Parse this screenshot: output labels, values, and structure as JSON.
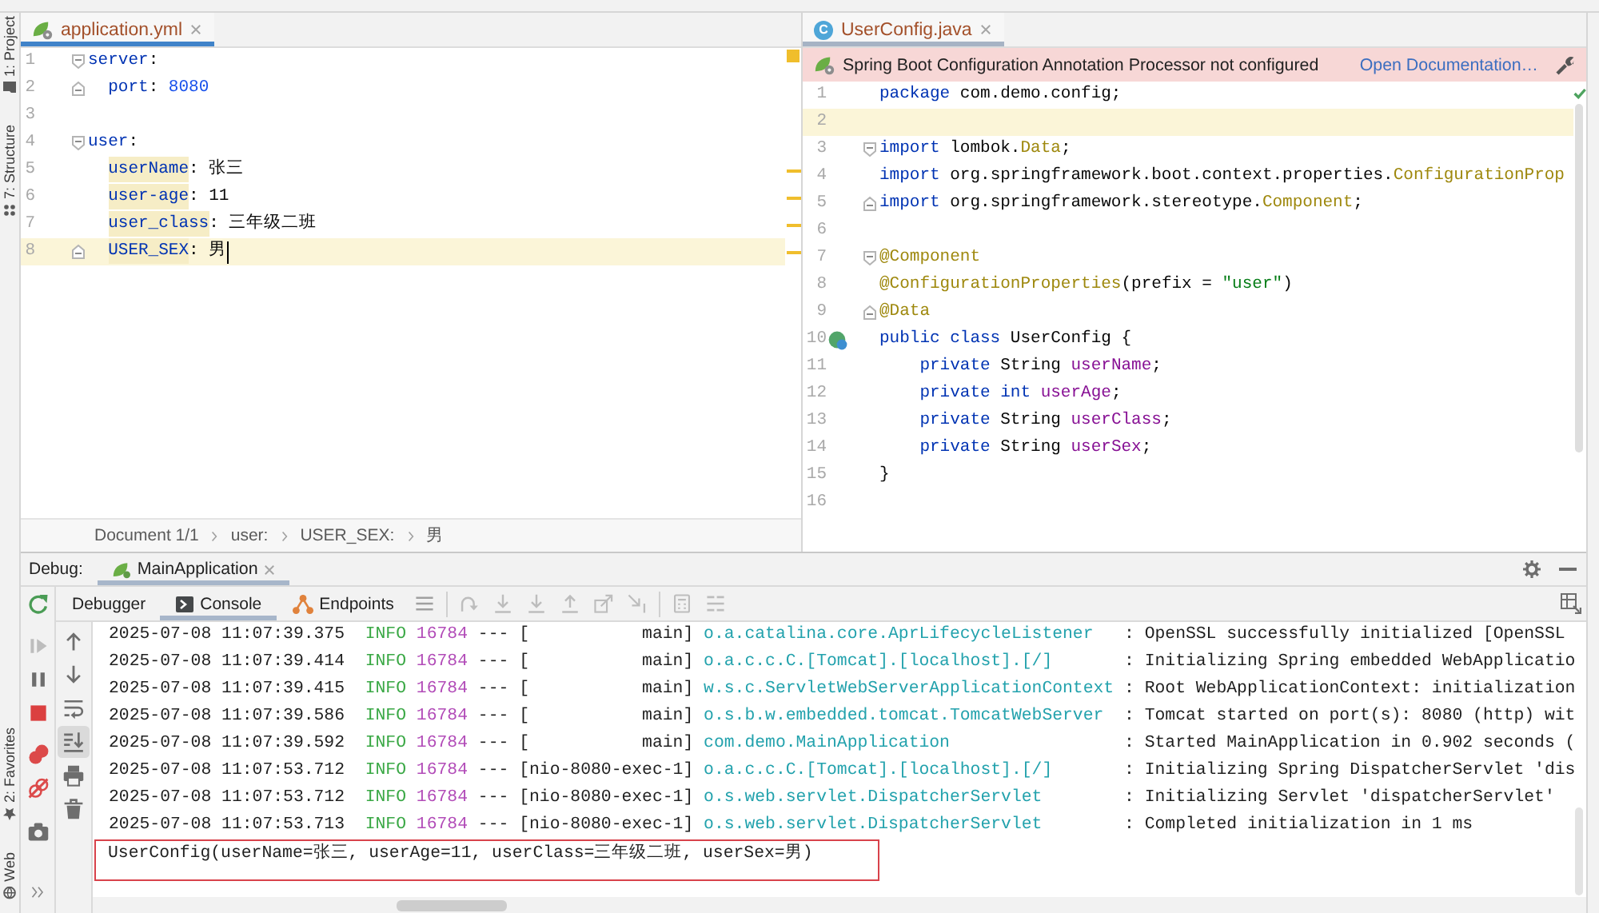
{
  "left_strip": {
    "top": [
      {
        "label": "1: Project",
        "kind": "project"
      },
      {
        "label": "7: Structure",
        "kind": "structure"
      }
    ],
    "bottom": [
      {
        "label": "2: Favorites",
        "kind": "favorites"
      },
      {
        "label": "Web",
        "kind": "web"
      }
    ]
  },
  "yaml_editor": {
    "tab": {
      "label": "application.yml",
      "kind": "yaml",
      "selected": true
    },
    "focused": true,
    "warnings": true,
    "lines": [
      {
        "number": "1",
        "marks": [
          {
            "kind": "fold_start"
          }
        ],
        "current": false,
        "tokens": [
          {
            "text": "server",
            "kind": "key"
          },
          {
            "text": ":",
            "kind": "punct"
          }
        ],
        "children": [
          {
            "number": "2",
            "marks": [
              {
                "kind": "fold_end"
              }
            ],
            "current": false,
            "tokens": [
              {
                "text": "port",
                "kind": "key"
              },
              {
                "text": ": ",
                "kind": "punct"
              },
              {
                "text": "8080",
                "kind": "number"
              }
            ]
          }
        ]
      },
      {
        "number": "3",
        "current": false
      },
      {
        "number": "4",
        "marks": [
          {
            "kind": "fold_start"
          }
        ],
        "current": false,
        "tokens": [
          {
            "text": "user",
            "kind": "key"
          },
          {
            "text": ":",
            "kind": "punct"
          }
        ],
        "children": [
          {
            "number": "5",
            "current": false,
            "tokens": [
              {
                "text": "userName",
                "kind": "flagged_key"
              },
              {
                "text": ": ",
                "kind": "punct"
              },
              {
                "text": "张三",
                "kind": "text"
              }
            ]
          },
          {
            "number": "6",
            "current": false,
            "tokens": [
              {
                "text": "user-age",
                "kind": "flagged_key"
              },
              {
                "text": ": ",
                "kind": "punct"
              },
              {
                "text": "11",
                "kind": "text"
              }
            ]
          },
          {
            "number": "7",
            "current": false,
            "tokens": [
              {
                "text": "user_class",
                "kind": "flagged_key"
              },
              {
                "text": ": ",
                "kind": "punct"
              },
              {
                "text": "三年级二班",
                "kind": "text"
              }
            ]
          },
          {
            "number": "8",
            "marks": [
              {
                "kind": "fold_end"
              }
            ],
            "current": true,
            "tokens": [
              {
                "text": "USER_SEX",
                "kind": "flagged_key"
              },
              {
                "text": ": ",
                "kind": "punct"
              },
              {
                "text": "男",
                "kind": "text"
              }
            ]
          }
        ]
      }
    ],
    "breadcrumbs": [
      "Document 1/1",
      "user:",
      "USER_SEX:",
      "男"
    ]
  },
  "java_editor": {
    "tab": {
      "label": "UserConfig.java",
      "kind": "java",
      "badge": "C",
      "selected": true
    },
    "banner": {
      "message": "Spring Boot Configuration Annotation Processor not configured",
      "link": "Open Documentation…"
    },
    "focused": false,
    "warnings": false,
    "lines": [
      {
        "number": "1",
        "current": false,
        "tokens": [
          {
            "text": "package",
            "kind": "keyword"
          },
          {
            "text": " com.demo.config;",
            "kind": "plain"
          }
        ]
      },
      {
        "number": "2",
        "current": true
      },
      {
        "number": "3",
        "marks": [
          {
            "kind": "fold_start"
          }
        ],
        "current": false,
        "tokens": [
          {
            "text": "import",
            "kind": "keyword"
          },
          {
            "text": " lombok.",
            "kind": "plain"
          },
          {
            "text": "Data",
            "kind": "annotation"
          },
          {
            "text": ";",
            "kind": "plain"
          }
        ]
      },
      {
        "number": "4",
        "current": false,
        "tokens": [
          {
            "text": "import",
            "kind": "keyword"
          },
          {
            "text": " org.springframework.boot.context.properties.",
            "kind": "plain"
          },
          {
            "text": "ConfigurationProp",
            "kind": "annotation"
          }
        ]
      },
      {
        "number": "5",
        "marks": [
          {
            "kind": "fold_end"
          }
        ],
        "current": false,
        "tokens": [
          {
            "text": "import",
            "kind": "keyword"
          },
          {
            "text": " org.springframework.stereotype.",
            "kind": "plain"
          },
          {
            "text": "Component",
            "kind": "annotation"
          },
          {
            "text": ";",
            "kind": "plain"
          }
        ]
      },
      {
        "number": "6",
        "current": false
      },
      {
        "number": "7",
        "marks": [
          {
            "kind": "fold_start"
          }
        ],
        "current": false,
        "tokens": [
          {
            "text": "@Component",
            "kind": "annotation"
          }
        ]
      },
      {
        "number": "8",
        "current": false,
        "tokens": [
          {
            "text": "@ConfigurationProperties",
            "kind": "annotation"
          },
          {
            "text": "(prefix = ",
            "kind": "plain"
          },
          {
            "text": "\"user\"",
            "kind": "string"
          },
          {
            "text": ")",
            "kind": "plain"
          }
        ]
      },
      {
        "number": "9",
        "marks": [
          {
            "kind": "fold_end"
          }
        ],
        "current": false,
        "tokens": [
          {
            "text": "@Data",
            "kind": "annotation"
          }
        ]
      },
      {
        "number": "10",
        "marks": [
          {
            "kind": "bean"
          }
        ],
        "current": false,
        "tokens": [
          {
            "text": "public class",
            "kind": "keyword"
          },
          {
            "text": " UserConfig {",
            "kind": "plain"
          }
        ],
        "children": [
          {
            "number": "11",
            "current": false,
            "tokens": [
              {
                "text": "private",
                "kind": "keyword"
              },
              {
                "text": " String ",
                "kind": "plain"
              },
              {
                "text": "userName",
                "kind": "field"
              },
              {
                "text": ";",
                "kind": "plain"
              }
            ]
          },
          {
            "number": "12",
            "current": false,
            "tokens": [
              {
                "text": "private int",
                "kind": "keyword"
              },
              {
                "text": " userAge",
                "kind": "field"
              },
              {
                "text": ";",
                "kind": "plain"
              }
            ]
          },
          {
            "number": "13",
            "current": false,
            "tokens": [
              {
                "text": "private",
                "kind": "keyword"
              },
              {
                "text": " String ",
                "kind": "plain"
              },
              {
                "text": "userClass",
                "kind": "field"
              },
              {
                "text": ";",
                "kind": "plain"
              }
            ]
          },
          {
            "number": "14",
            "current": false,
            "tokens": [
              {
                "text": "private",
                "kind": "keyword"
              },
              {
                "text": " String ",
                "kind": "plain"
              },
              {
                "text": "userSex",
                "kind": "field"
              },
              {
                "text": ";",
                "kind": "plain"
              }
            ]
          }
        ]
      },
      {
        "number": "15",
        "current": false,
        "tokens": [
          {
            "text": "}",
            "kind": "plain"
          }
        ]
      },
      {
        "number": "16",
        "current": false
      }
    ]
  },
  "debug": {
    "title": "Debug:",
    "sessions": [
      {
        "label": "MainApplication",
        "selected": true
      }
    ],
    "actions": [
      {
        "kind": "rerun",
        "disabled": false
      },
      {
        "kind": "resume",
        "disabled": true
      },
      {
        "kind": "pause",
        "disabled": false
      },
      {
        "kind": "stop",
        "disabled": false
      },
      {
        "kind": "breakpoints",
        "disabled": false
      },
      {
        "kind": "mute",
        "disabled": false
      },
      {
        "kind": "camera",
        "disabled": false
      },
      {
        "kind": "more",
        "disabled": false
      }
    ],
    "tabs": [
      {
        "label": "Debugger",
        "kind": "debugger",
        "selected": false
      },
      {
        "label": "Console",
        "kind": "console",
        "selected": true
      },
      {
        "label": "Endpoints",
        "kind": "endpoints",
        "selected": false
      }
    ],
    "toolbar_groups": [
      [
        {
          "kind": "menu",
          "disabled": false
        }
      ],
      [
        {
          "kind": "execution_point",
          "disabled": true
        },
        {
          "kind": "step_over",
          "disabled": true
        },
        {
          "kind": "step_into",
          "disabled": true
        },
        {
          "kind": "step_out",
          "disabled": true
        },
        {
          "kind": "drop_frame",
          "disabled": true
        },
        {
          "kind": "run_to_cursor",
          "disabled": true
        }
      ],
      [
        {
          "kind": "evaluate",
          "disabled": true
        },
        {
          "kind": "trace",
          "disabled": true
        }
      ]
    ],
    "console_tools": [
      {
        "kind": "up",
        "on": false
      },
      {
        "kind": "down",
        "on": false
      },
      {
        "kind": "wrap",
        "on": false
      },
      {
        "kind": "scroll_end",
        "on": true
      },
      {
        "kind": "print",
        "on": false
      },
      {
        "kind": "clear",
        "on": false
      }
    ],
    "console": {
      "lines": [
        {
          "kind": "log",
          "timestamp": "2025-07-08 11:07:39.375",
          "level": "INFO",
          "pid": "16784",
          "separator": "---",
          "thread": "[           main]",
          "logger": "o.a.catalina.core.AprLifecycleListener",
          "message": ": OpenSSL successfully initialized [OpenSSL"
        },
        {
          "kind": "log",
          "timestamp": "2025-07-08 11:07:39.414",
          "level": "INFO",
          "pid": "16784",
          "separator": "---",
          "thread": "[           main]",
          "logger": "o.a.c.c.C.[Tomcat].[localhost].[/]",
          "message": ": Initializing Spring embedded WebApplicatio"
        },
        {
          "kind": "log",
          "timestamp": "2025-07-08 11:07:39.415",
          "level": "INFO",
          "pid": "16784",
          "separator": "---",
          "thread": "[           main]",
          "logger": "w.s.c.ServletWebServerApplicationContext",
          "message": ": Root WebApplicationContext: initialization"
        },
        {
          "kind": "log",
          "timestamp": "2025-07-08 11:07:39.586",
          "level": "INFO",
          "pid": "16784",
          "separator": "---",
          "thread": "[           main]",
          "logger": "o.s.b.w.embedded.tomcat.TomcatWebServer",
          "message": ": Tomcat started on port(s): 8080 (http) wit"
        },
        {
          "kind": "log",
          "timestamp": "2025-07-08 11:07:39.592",
          "level": "INFO",
          "pid": "16784",
          "separator": "---",
          "thread": "[           main]",
          "logger": "com.demo.MainApplication",
          "message": ": Started MainApplication in 0.902 seconds ("
        },
        {
          "kind": "log",
          "timestamp": "2025-07-08 11:07:53.712",
          "level": "INFO",
          "pid": "16784",
          "separator": "---",
          "thread": "[nio-8080-exec-1]",
          "logger": "o.a.c.c.C.[Tomcat].[localhost].[/]",
          "message": ": Initializing Spring DispatcherServlet 'dis"
        },
        {
          "kind": "log",
          "timestamp": "2025-07-08 11:07:53.712",
          "level": "INFO",
          "pid": "16784",
          "separator": "---",
          "thread": "[nio-8080-exec-1]",
          "logger": "o.s.web.servlet.DispatcherServlet",
          "message": ": Initializing Servlet 'dispatcherServlet'"
        },
        {
          "kind": "log",
          "timestamp": "2025-07-08 11:07:53.713",
          "level": "INFO",
          "pid": "16784",
          "separator": "---",
          "thread": "[nio-8080-exec-1]",
          "logger": "o.s.web.servlet.DispatcherServlet",
          "message": ": Completed initialization in 1 ms"
        },
        {
          "kind": "output",
          "text": "UserConfig(userName=张三, userAge=11, userClass=三年级二班, userSex=男)",
          "boxed": true
        }
      ]
    }
  }
}
